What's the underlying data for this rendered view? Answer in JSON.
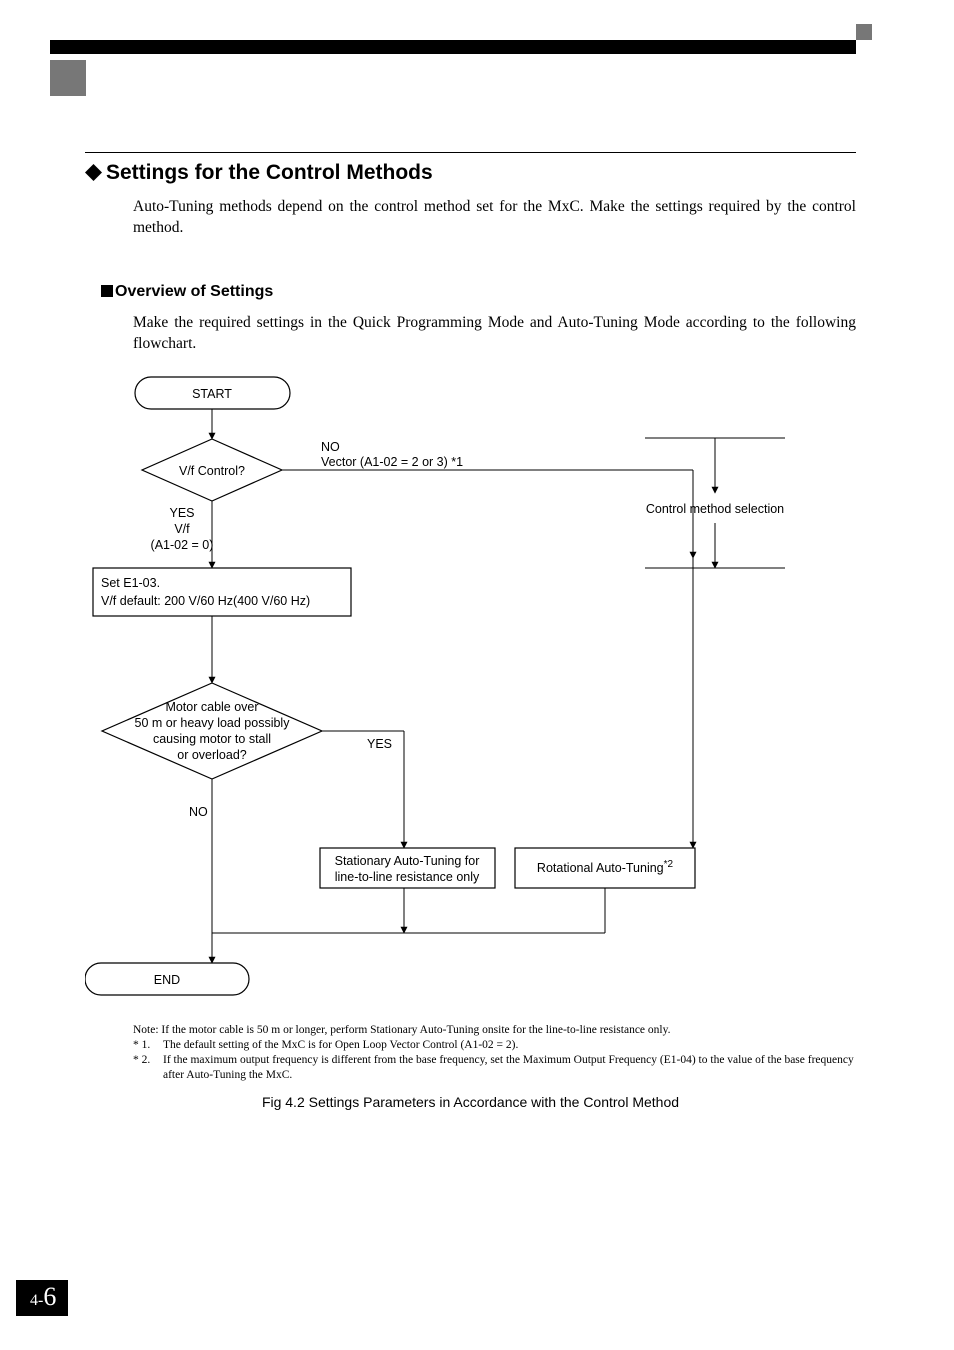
{
  "header": {
    "section_title": "Settings for the Control Methods",
    "intro": "Auto-Tuning methods depend on the control method set for the MxC. Make the settings required by the control method.",
    "sub_title": "Overview of Settings",
    "sub_body": "Make the required settings in the Quick Programming Mode and Auto-Tuning Mode according to the following flowchart."
  },
  "flowchart": {
    "start": "START",
    "end": "END",
    "decision_vf": "V/f Control?",
    "decision_vf_no_label": "NO",
    "decision_vf_no_detail": "Vector (A1-02 = 2 or 3) *1",
    "decision_vf_yes_label": "YES",
    "decision_vf_yes_detail_l1": "V/f",
    "decision_vf_yes_detail_l2": "(A1-02 = 0)",
    "process_e103_l1": "Set E1-03.",
    "process_e103_l2": "V/f default: 200 V/60 Hz(400 V/60 Hz)",
    "control_method_selection": "Control method selection",
    "decision_cable_l1": "Motor cable over",
    "decision_cable_l2": "50 m or heavy load possibly",
    "decision_cable_l3": "causing motor to stall",
    "decision_cable_l4": "or overload?",
    "decision_cable_yes": "YES",
    "decision_cable_no": "NO",
    "process_stationary_l1": "Stationary Auto-Tuning for",
    "process_stationary_l2": "line-to-line resistance only",
    "process_rotational": "Rotational Auto-Tuning",
    "process_rotational_sup": "*2"
  },
  "notes": {
    "line0": "Note: If the motor cable is 50 m or longer, perform Stationary Auto-Tuning onsite for the line-to-line resistance only.",
    "k1": "*  1.",
    "v1": "The default setting of the MxC is for Open Loop Vector Control (A1-02 = 2).",
    "k2": "*  2.",
    "v2": "If the maximum output frequency is different from the base frequency, set the Maximum Output Frequency (E1-04) to the value of the base frequency after Auto-Tuning the MxC."
  },
  "caption": "Fig 4.2  Settings Parameters in Accordance with the Control Method",
  "page": {
    "chapter": "4",
    "sep": "-",
    "num": "6"
  }
}
